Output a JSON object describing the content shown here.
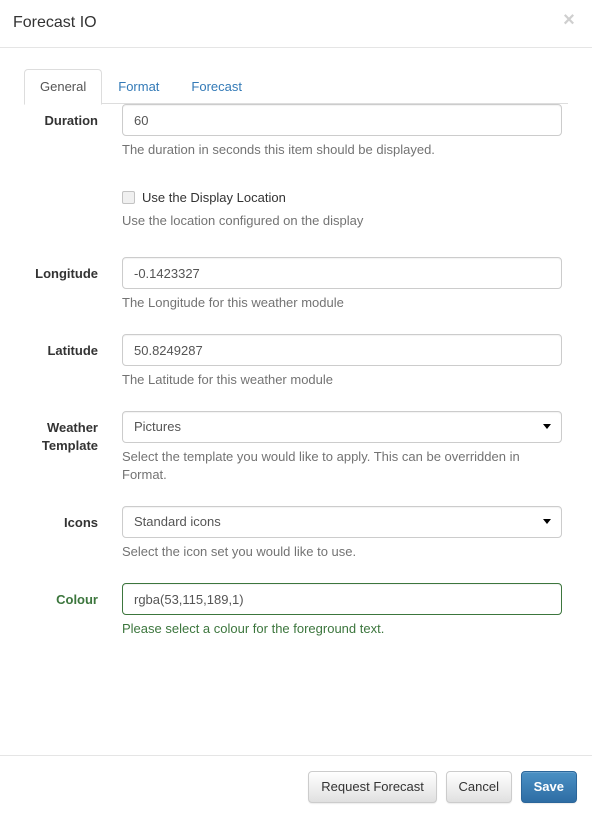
{
  "header": {
    "title": "Forecast IO",
    "close_label": "×"
  },
  "tabs": [
    {
      "label": "General",
      "active": true
    },
    {
      "label": "Format",
      "active": false
    },
    {
      "label": "Forecast",
      "active": false
    }
  ],
  "form": {
    "duration": {
      "label": "Duration",
      "value": "60",
      "help": "The duration in seconds this item should be displayed."
    },
    "use_display_location": {
      "label": "Use the Display Location",
      "checked": false,
      "help": "Use the location configured on the display"
    },
    "longitude": {
      "label": "Longitude",
      "value": "-0.1423327",
      "help": "The Longitude for this weather module"
    },
    "latitude": {
      "label": "Latitude",
      "value": "50.8249287",
      "help": "The Latitude for this weather module"
    },
    "weather_template": {
      "label": "Weather Template",
      "label_line1": "Weather",
      "label_line2": "Template",
      "value": "Pictures",
      "help": "Select the template you would like to apply. This can be overridden in Format."
    },
    "icons": {
      "label": "Icons",
      "value": "Standard icons",
      "help": "Select the icon set you would like to use."
    },
    "colour": {
      "label": "Colour",
      "value": "rgba(53,115,189,1)",
      "help": "Please select a colour for the foreground text.",
      "state": "success",
      "state_colour": "#3c763d"
    }
  },
  "footer": {
    "request_forecast_label": "Request Forecast",
    "cancel_label": "Cancel",
    "save_label": "Save"
  },
  "colors": {
    "link": "#337ab7",
    "primary_button": "#337ab7",
    "success": "#3c763d",
    "help_text": "#737373",
    "border": "#cccccc"
  }
}
